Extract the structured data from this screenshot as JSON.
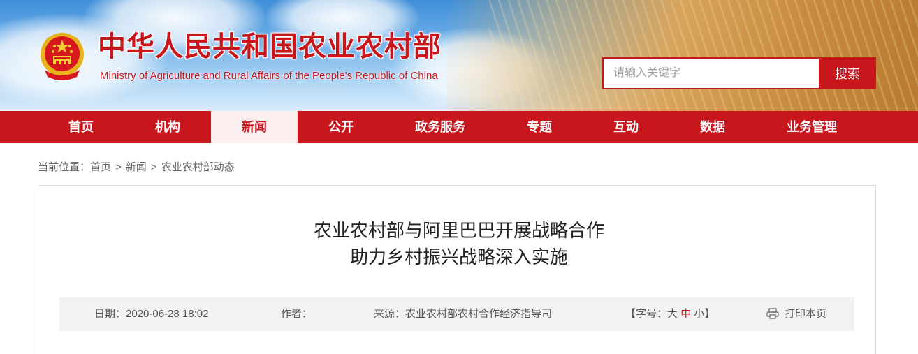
{
  "header": {
    "title_cn": "中华人民共和国农业农村部",
    "title_en": "Ministry of Agriculture and Rural Affairs of the People's Republic of China",
    "emblem_icon": "national-emblem-icon"
  },
  "search": {
    "placeholder": "请输入关键字",
    "button_label": "搜索"
  },
  "nav": {
    "items": [
      {
        "label": "首页"
      },
      {
        "label": "机构"
      },
      {
        "label": "新闻"
      },
      {
        "label": "公开"
      },
      {
        "label": "政务服务"
      },
      {
        "label": "专题"
      },
      {
        "label": "互动"
      },
      {
        "label": "数据"
      },
      {
        "label": "业务管理"
      }
    ],
    "active": "新闻"
  },
  "breadcrumb": {
    "prefix": "当前位置：",
    "items": [
      "首页",
      "新闻",
      "农业农村部动态"
    ],
    "separator": ">"
  },
  "article": {
    "title_line1": "农业农村部与阿里巴巴开展战略合作",
    "title_line2": "助力乡村振兴战略深入实施",
    "meta": {
      "date_label": "日期：",
      "date_value": "2020-06-28 18:02",
      "author_label": "作者：",
      "author_value": "",
      "source_label": "来源：",
      "source_value": "农业农村部农村合作经济指导司",
      "font_size_open": "【字号：",
      "font_large": "大",
      "font_medium": "中",
      "font_small": "小",
      "font_size_close": "】",
      "print_label": "打印本页",
      "print_icon": "printer-icon"
    }
  },
  "colors": {
    "brand_red": "#c8161d",
    "active_nav_bg": "#fbeeee",
    "meta_bg": "#f2f2f2"
  }
}
